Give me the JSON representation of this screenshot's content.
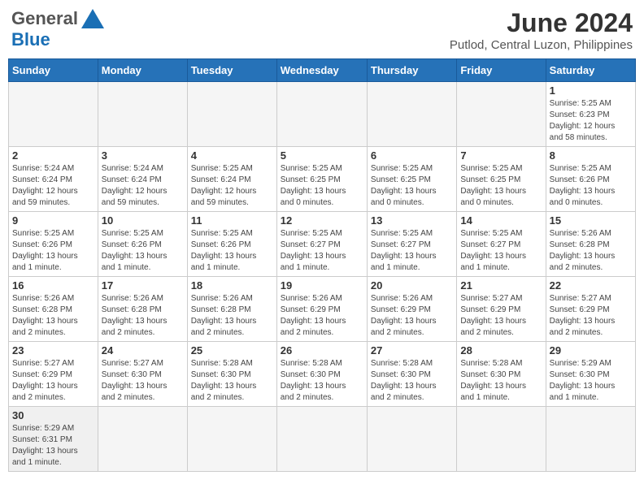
{
  "header": {
    "logo_general": "General",
    "logo_blue": "Blue",
    "month_title": "June 2024",
    "subtitle": "Putlod, Central Luzon, Philippines"
  },
  "days_of_week": [
    "Sunday",
    "Monday",
    "Tuesday",
    "Wednesday",
    "Thursday",
    "Friday",
    "Saturday"
  ],
  "weeks": [
    [
      {
        "day": "",
        "info": ""
      },
      {
        "day": "",
        "info": ""
      },
      {
        "day": "",
        "info": ""
      },
      {
        "day": "",
        "info": ""
      },
      {
        "day": "",
        "info": ""
      },
      {
        "day": "",
        "info": ""
      },
      {
        "day": "1",
        "info": "Sunrise: 5:25 AM\nSunset: 6:23 PM\nDaylight: 12 hours\nand 58 minutes."
      }
    ],
    [
      {
        "day": "2",
        "info": "Sunrise: 5:24 AM\nSunset: 6:24 PM\nDaylight: 12 hours\nand 59 minutes."
      },
      {
        "day": "3",
        "info": "Sunrise: 5:24 AM\nSunset: 6:24 PM\nDaylight: 12 hours\nand 59 minutes."
      },
      {
        "day": "4",
        "info": "Sunrise: 5:25 AM\nSunset: 6:24 PM\nDaylight: 12 hours\nand 59 minutes."
      },
      {
        "day": "5",
        "info": "Sunrise: 5:25 AM\nSunset: 6:25 PM\nDaylight: 13 hours\nand 0 minutes."
      },
      {
        "day": "6",
        "info": "Sunrise: 5:25 AM\nSunset: 6:25 PM\nDaylight: 13 hours\nand 0 minutes."
      },
      {
        "day": "7",
        "info": "Sunrise: 5:25 AM\nSunset: 6:25 PM\nDaylight: 13 hours\nand 0 minutes."
      },
      {
        "day": "8",
        "info": "Sunrise: 5:25 AM\nSunset: 6:26 PM\nDaylight: 13 hours\nand 0 minutes."
      }
    ],
    [
      {
        "day": "9",
        "info": "Sunrise: 5:25 AM\nSunset: 6:26 PM\nDaylight: 13 hours\nand 1 minute."
      },
      {
        "day": "10",
        "info": "Sunrise: 5:25 AM\nSunset: 6:26 PM\nDaylight: 13 hours\nand 1 minute."
      },
      {
        "day": "11",
        "info": "Sunrise: 5:25 AM\nSunset: 6:26 PM\nDaylight: 13 hours\nand 1 minute."
      },
      {
        "day": "12",
        "info": "Sunrise: 5:25 AM\nSunset: 6:27 PM\nDaylight: 13 hours\nand 1 minute."
      },
      {
        "day": "13",
        "info": "Sunrise: 5:25 AM\nSunset: 6:27 PM\nDaylight: 13 hours\nand 1 minute."
      },
      {
        "day": "14",
        "info": "Sunrise: 5:25 AM\nSunset: 6:27 PM\nDaylight: 13 hours\nand 1 minute."
      },
      {
        "day": "15",
        "info": "Sunrise: 5:26 AM\nSunset: 6:28 PM\nDaylight: 13 hours\nand 2 minutes."
      }
    ],
    [
      {
        "day": "16",
        "info": "Sunrise: 5:26 AM\nSunset: 6:28 PM\nDaylight: 13 hours\nand 2 minutes."
      },
      {
        "day": "17",
        "info": "Sunrise: 5:26 AM\nSunset: 6:28 PM\nDaylight: 13 hours\nand 2 minutes."
      },
      {
        "day": "18",
        "info": "Sunrise: 5:26 AM\nSunset: 6:28 PM\nDaylight: 13 hours\nand 2 minutes."
      },
      {
        "day": "19",
        "info": "Sunrise: 5:26 AM\nSunset: 6:29 PM\nDaylight: 13 hours\nand 2 minutes."
      },
      {
        "day": "20",
        "info": "Sunrise: 5:26 AM\nSunset: 6:29 PM\nDaylight: 13 hours\nand 2 minutes."
      },
      {
        "day": "21",
        "info": "Sunrise: 5:27 AM\nSunset: 6:29 PM\nDaylight: 13 hours\nand 2 minutes."
      },
      {
        "day": "22",
        "info": "Sunrise: 5:27 AM\nSunset: 6:29 PM\nDaylight: 13 hours\nand 2 minutes."
      }
    ],
    [
      {
        "day": "23",
        "info": "Sunrise: 5:27 AM\nSunset: 6:29 PM\nDaylight: 13 hours\nand 2 minutes."
      },
      {
        "day": "24",
        "info": "Sunrise: 5:27 AM\nSunset: 6:30 PM\nDaylight: 13 hours\nand 2 minutes."
      },
      {
        "day": "25",
        "info": "Sunrise: 5:28 AM\nSunset: 6:30 PM\nDaylight: 13 hours\nand 2 minutes."
      },
      {
        "day": "26",
        "info": "Sunrise: 5:28 AM\nSunset: 6:30 PM\nDaylight: 13 hours\nand 2 minutes."
      },
      {
        "day": "27",
        "info": "Sunrise: 5:28 AM\nSunset: 6:30 PM\nDaylight: 13 hours\nand 2 minutes."
      },
      {
        "day": "28",
        "info": "Sunrise: 5:28 AM\nSunset: 6:30 PM\nDaylight: 13 hours\nand 1 minute."
      },
      {
        "day": "29",
        "info": "Sunrise: 5:29 AM\nSunset: 6:30 PM\nDaylight: 13 hours\nand 1 minute."
      }
    ],
    [
      {
        "day": "30",
        "info": "Sunrise: 5:29 AM\nSunset: 6:31 PM\nDaylight: 13 hours\nand 1 minute."
      },
      {
        "day": "",
        "info": ""
      },
      {
        "day": "",
        "info": ""
      },
      {
        "day": "",
        "info": ""
      },
      {
        "day": "",
        "info": ""
      },
      {
        "day": "",
        "info": ""
      },
      {
        "day": "",
        "info": ""
      }
    ]
  ]
}
